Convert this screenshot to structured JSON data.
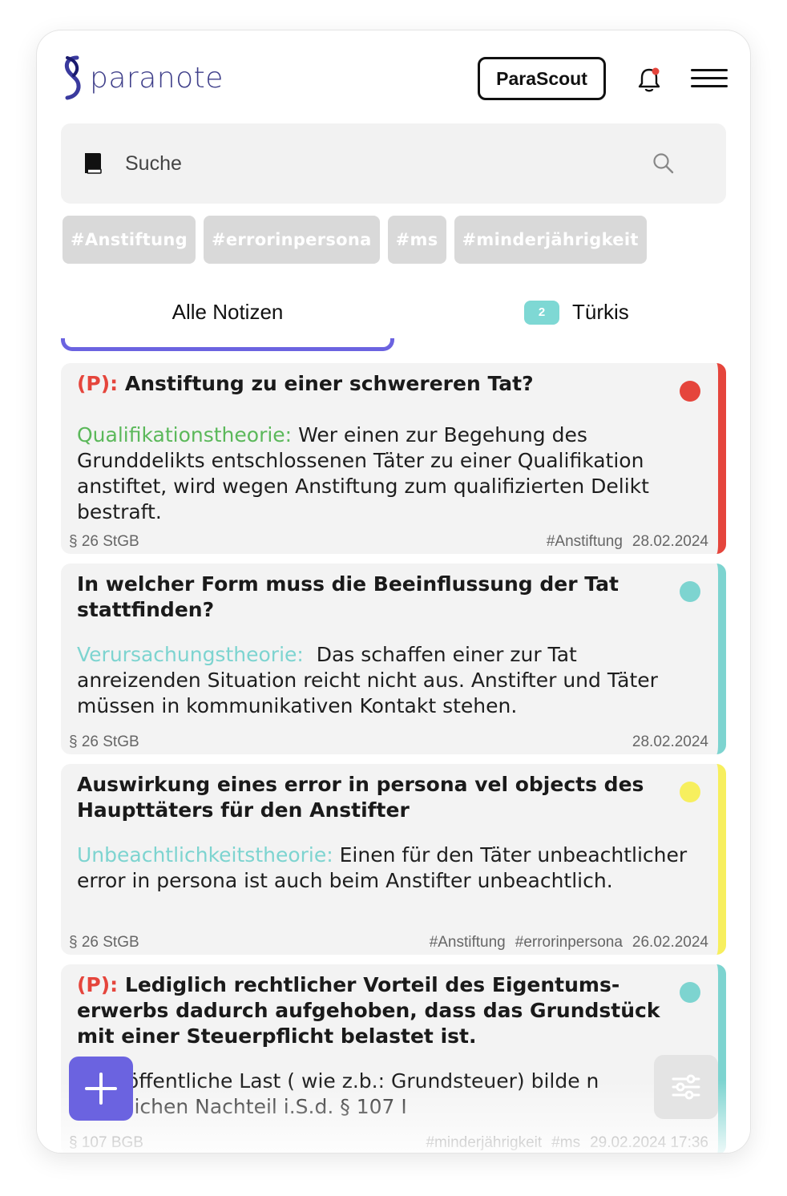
{
  "header": {
    "logo_text": "paranote",
    "parascout_label": "ParaScout"
  },
  "search": {
    "placeholder": "Suche"
  },
  "tags": [
    "#Anstiftung",
    "#errorinpersona",
    "#ms",
    "#minderjährigkeit"
  ],
  "tabs": {
    "all_label": "Alle Notizen",
    "tuerkis_label": "Türkis",
    "tuerkis_count": "2"
  },
  "colors": {
    "accent": "#6b63e0",
    "red": "#e5453c",
    "teal": "#7dd4d0",
    "yellow": "#f7ef5e",
    "green": "#5bb85a"
  },
  "notes": [
    {
      "prefix": "(P):",
      "title": "Anstiftung zu einer schwereren Tat?",
      "theory": "Qualifikationstheorie:",
      "text": "Wer einen zur Begehung des Grunddelikts entschlossenen Täter zu einer Qualifikation anstiftet, wird wegen Anstiftung zum qualifizierten Delikt bestraft.",
      "law": "§ 26 StGB",
      "tags": [
        "#Anstiftung"
      ],
      "date": "28.02.2024",
      "color": "#e5453c"
    },
    {
      "prefix": "",
      "title": "In welcher Form muss die Beeinflussung der Tat stattfinden?",
      "theory": "Verursachungstheorie:",
      "text": "Das schaffen einer zur Tat anreizenden Situation reicht nicht aus. Anstifter und Täter müssen in kommunikativen Kontakt stehen.",
      "law": "§ 26 StGB",
      "tags": [],
      "date": "28.02.2024",
      "color": "#7dd4d0"
    },
    {
      "prefix": "",
      "title": "Auswirkung eines error in persona vel objects des Haupttäters für den Anstifter",
      "theory": "Unbeachtlichkeitstheorie:",
      "text": "Einen für den Täter unbeachtlicher error in persona ist auch beim Anstifter unbeachtlich.",
      "law": "§ 26 StGB",
      "tags": [
        "#Anstiftung",
        "#errorinpersona"
      ],
      "date": "26.02.2024",
      "color": "#f7ef5e"
    },
    {
      "prefix": "(P):",
      "title": "Lediglich rechtlicher Vorteil des Eigentums-erwerbs dadurch aufgehoben, dass das Grundstück mit einer Steuerpflicht belastet ist.",
      "theory": "",
      "text": "Eine öffentliche Last ( wie z.b.: Grundsteuer) bilde n rechtlichen Nachteil i.S.d. § 107 I",
      "law": "§ 107 BGB",
      "tags": [
        "#minderjährigkeit",
        "#ms"
      ],
      "date": "29.02.2024 17:36",
      "color": "#7dd4d0"
    }
  ]
}
